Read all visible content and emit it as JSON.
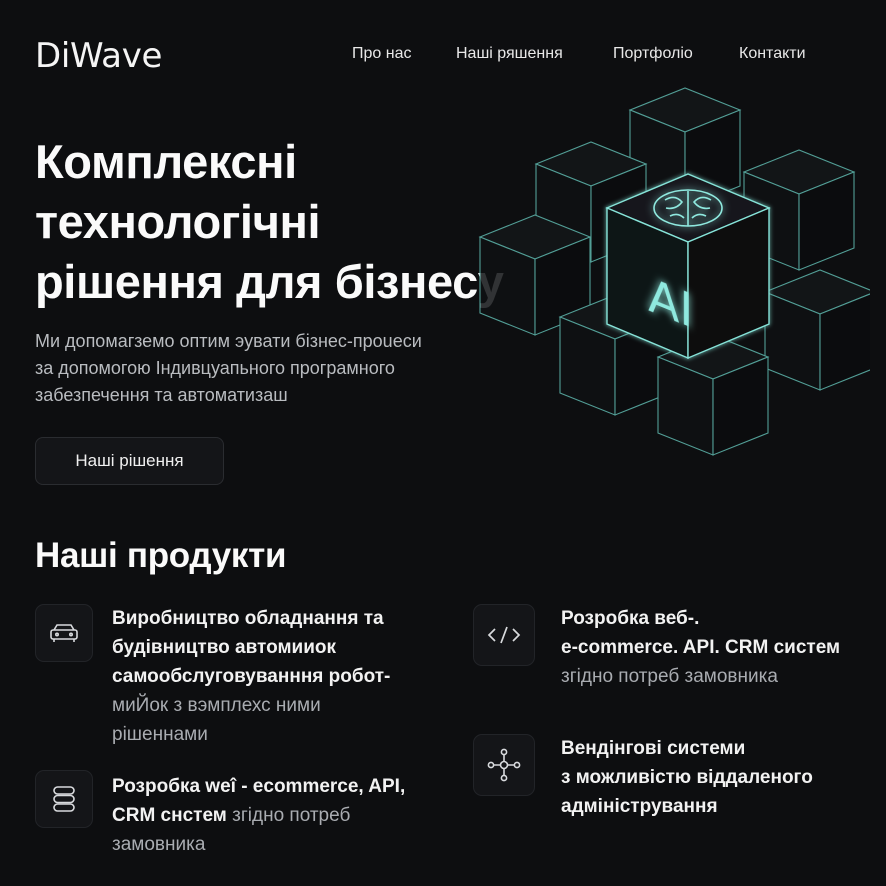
{
  "brand": {
    "logo": "DiWave"
  },
  "nav": {
    "items": [
      {
        "label": "Про нас"
      },
      {
        "label": "Наші ряшення"
      },
      {
        "label": "Портфоліо"
      },
      {
        "label": "Контакти"
      }
    ]
  },
  "hero": {
    "title_lines": [
      "Комплексні",
      "технологічні",
      "рішення для бізнесу"
    ],
    "subtitle_lines": [
      "Ми допомагземо оптим эувати бізнес-проuеси",
      "за допомогою Індивцуапьного програмного",
      "забезпечення та автоматизаш"
    ],
    "cta_label": "Наші рішення",
    "graphic_label": "AI"
  },
  "products": {
    "title": "Наші продукти",
    "items": [
      {
        "icon": "car-icon",
        "bold_lines": [
          "Виробництво обладнання та",
          "будівництво автомииок",
          "самообслуговуванння робот-"
        ],
        "muted_lines": [
          "миЙок з вэмплехс ними",
          "рішеннами"
        ]
      },
      {
        "icon": "database-icon",
        "bold_a": "Розробка weî - ecommerce, API,",
        "bold_b": "CRM снстем",
        "muted_b": " згідно потреб",
        "muted_c": "замовника"
      },
      {
        "icon": "code-icon",
        "bold_lines": [
          "Розробка веб-.",
          "e-commerce. API. CRM систем"
        ],
        "muted_lines": [
          "згідно потреб замовника"
        ]
      },
      {
        "icon": "network-icon",
        "bold_lines": [
          "Вендінгові системи",
          "з можливістю віддаленого",
          "адміністрування"
        ]
      }
    ]
  },
  "colors": {
    "background": "#0d0e10",
    "accent_glow": "#7fd9cf",
    "card_border": "#222428"
  }
}
